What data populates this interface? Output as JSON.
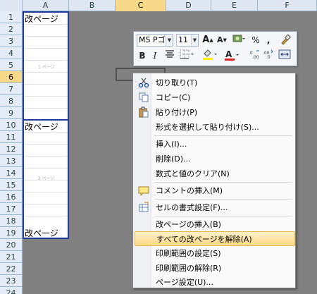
{
  "columns": [
    "A",
    "B",
    "C",
    "D",
    "E",
    "F"
  ],
  "selected_column": "C",
  "rows": [
    "1",
    "2",
    "3",
    "4",
    "5",
    "6",
    "7",
    "8",
    "9",
    "10",
    "11",
    "12",
    "13",
    "14",
    "15",
    "16",
    "17",
    "18",
    "19",
    "20",
    "21",
    "22",
    "23",
    "24"
  ],
  "selected_row": "6",
  "page_labels": [
    "改ページ",
    "改ページ",
    "改ページ"
  ],
  "page_watermarks": [
    "1 ページ",
    "2 ページ"
  ],
  "mini_toolbar": {
    "font_name": "MS Pゴ",
    "font_size": "11",
    "grow_label": "A",
    "shrink_label": "A",
    "percent_label": "%",
    "comma_label": ",",
    "bold_label": "B",
    "italic_label": "I",
    "font_color_label": "A",
    "font_color": "#e02020",
    "fill_color": "#ffee00"
  },
  "context_menu": {
    "items": [
      {
        "label": "切り取り(T)",
        "icon": "scissors-icon"
      },
      {
        "label": "コピー(C)",
        "icon": "copy-icon"
      },
      {
        "label": "貼り付け(P)",
        "icon": "paste-icon"
      },
      {
        "label": "形式を選択して貼り付け(S)...",
        "icon": ""
      },
      {
        "label": "挿入(I)...",
        "icon": ""
      },
      {
        "label": "削除(D)...",
        "icon": ""
      },
      {
        "label": "数式と値のクリア(N)",
        "icon": ""
      },
      {
        "label": "コメントの挿入(M)",
        "icon": "comment-icon"
      },
      {
        "label": "セルの書式設定(F)...",
        "icon": "format-cells-icon"
      },
      {
        "label": "改ページの挿入(B)",
        "icon": ""
      },
      {
        "label": "すべての改ページを解除(A)",
        "icon": "",
        "highlighted": true
      },
      {
        "label": "印刷範囲の設定(S)",
        "icon": ""
      },
      {
        "label": "印刷範囲の解除(R)",
        "icon": ""
      },
      {
        "label": "ページ設定(U)...",
        "icon": ""
      }
    ]
  }
}
